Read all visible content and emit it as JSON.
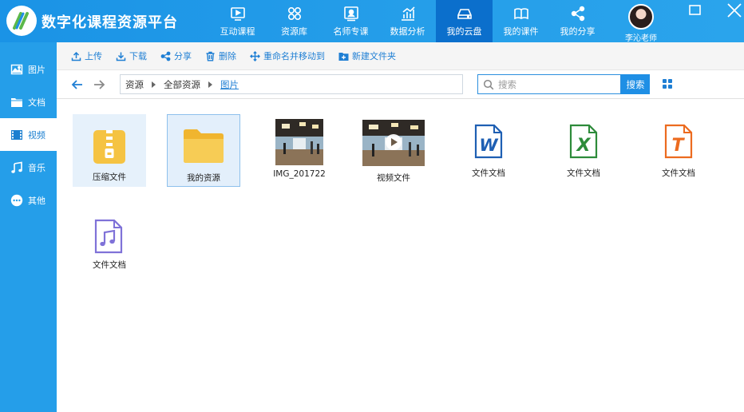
{
  "app": {
    "title": "数字化课程资源平台"
  },
  "nav": [
    {
      "label": "互动课程",
      "icon": "play-screen-icon"
    },
    {
      "label": "资源库",
      "icon": "resource-grid-icon"
    },
    {
      "label": "名师专课",
      "icon": "teacher-board-icon"
    },
    {
      "label": "数据分析",
      "icon": "chart-icon"
    },
    {
      "label": "我的云盘",
      "icon": "cloud-drive-icon",
      "active": true
    },
    {
      "label": "我的课件",
      "icon": "book-icon"
    },
    {
      "label": "我的分享",
      "icon": "share-icon"
    }
  ],
  "user": {
    "name": "李沁老师"
  },
  "sidebar": {
    "items": [
      {
        "label": "图片",
        "icon": "image-icon"
      },
      {
        "label": "文档",
        "icon": "folder-icon"
      },
      {
        "label": "视频",
        "icon": "film-icon",
        "active": true
      },
      {
        "label": "音乐",
        "icon": "music-icon"
      },
      {
        "label": "其他",
        "icon": "more-icon"
      }
    ]
  },
  "toolbar": {
    "upload": "上传",
    "download": "下载",
    "share": "分享",
    "delete": "删除",
    "rename_move": "重命名并移动到",
    "new_folder": "新建文件夹"
  },
  "breadcrumb": [
    "资源",
    "全部资源",
    "图片"
  ],
  "search": {
    "placeholder": "搜索",
    "button": "搜索"
  },
  "files": [
    {
      "name": "压缩文件",
      "icon": "zip-icon"
    },
    {
      "name": "我的资源",
      "icon": "folder-icon"
    },
    {
      "name": "IMG_201722",
      "icon": "photo-thumbnail"
    },
    {
      "name": "视频文件",
      "icon": "video-thumbnail"
    },
    {
      "name": "文件文档",
      "icon": "word-icon"
    },
    {
      "name": "文件文档",
      "icon": "excel-icon"
    },
    {
      "name": "文件文档",
      "icon": "text-icon"
    },
    {
      "name": "文件文档",
      "icon": "audio-file-icon"
    }
  ],
  "colors": {
    "primary": "#259ee9",
    "active_nav": "#0b6fcc",
    "link": "#1f7fd4",
    "folder": "#f5c342"
  }
}
